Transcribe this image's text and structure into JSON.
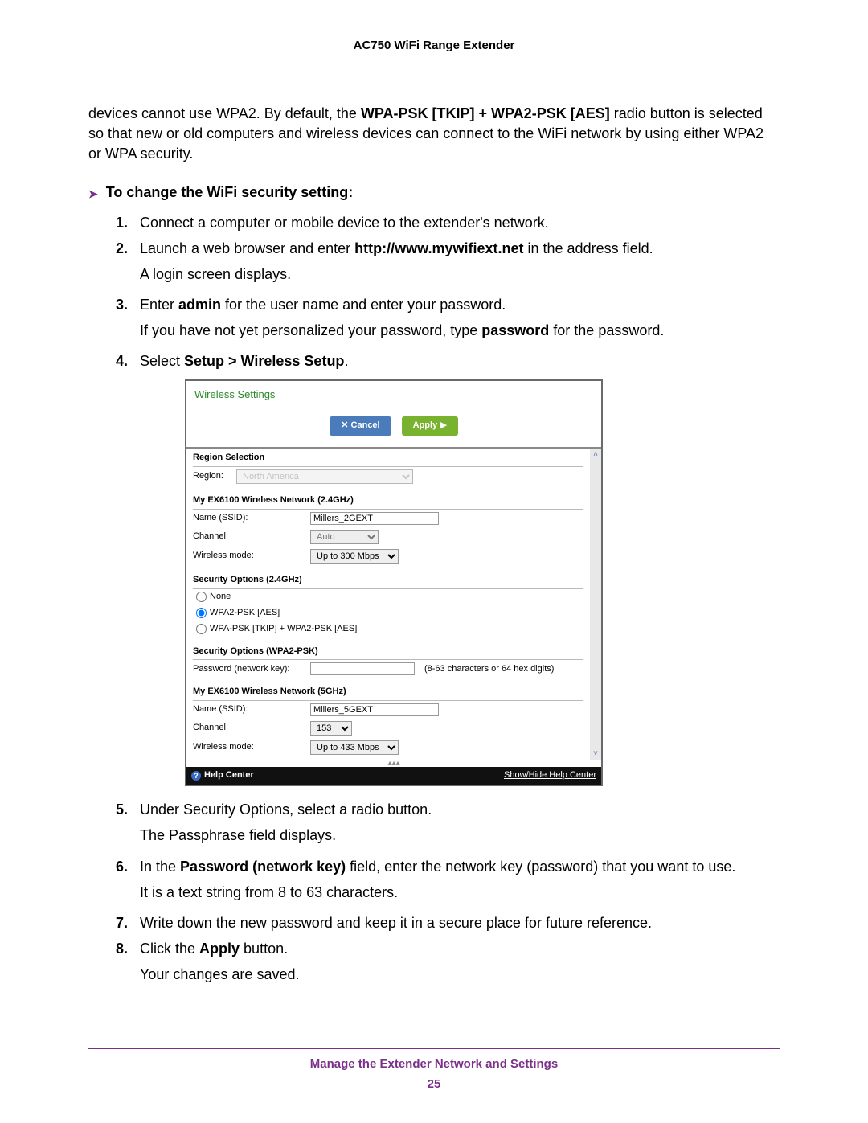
{
  "header": {
    "title": "AC750 WiFi Range Extender"
  },
  "intro": {
    "prefix": "devices cannot use WPA2. By default, the ",
    "bold": "WPA-PSK [TKIP] + WPA2-PSK [AES]",
    "suffix": " radio button is selected so that new or old computers and wireless devices can connect to the WiFi network by using either WPA2 or WPA security."
  },
  "heading": "To change the WiFi security setting:",
  "steps": {
    "s1": {
      "num": "1.",
      "text": "Connect a computer or mobile device to the extender's network."
    },
    "s2": {
      "num": "2.",
      "pre": "Launch a web browser and enter ",
      "bold": "http://www.mywifiext.net",
      "post": " in the address field.",
      "sub": "A login screen displays."
    },
    "s3": {
      "num": "3.",
      "pre": "Enter ",
      "bold1": "admin",
      "mid": " for the user name and enter your password.",
      "sub_pre": "If you have not yet personalized your password, type ",
      "sub_bold": "password",
      "sub_post": " for the password."
    },
    "s4": {
      "num": "4.",
      "pre": "Select ",
      "bold": "Setup > Wireless Setup",
      "post": "."
    },
    "s5": {
      "num": "5.",
      "text": "Under Security Options, select a radio button.",
      "sub": "The Passphrase field displays."
    },
    "s6": {
      "num": "6.",
      "pre": "In the ",
      "bold": "Password (network key)",
      "post": " field, enter the network key (password) that you want to use.",
      "sub": "It is a text string from 8 to 63 characters."
    },
    "s7": {
      "num": "7.",
      "text": "Write down the new password and keep it in a secure place for future reference."
    },
    "s8": {
      "num": "8.",
      "pre": "Click the ",
      "bold": "Apply",
      "post": " button.",
      "sub": "Your changes are saved."
    }
  },
  "shot": {
    "title": "Wireless Settings",
    "cancel": "✕ Cancel",
    "apply": "Apply ▶",
    "region_head": "Region Selection",
    "region_label": "Region:",
    "region_value": "North America",
    "net24_head": "My EX6100 Wireless Network (2.4GHz)",
    "ssid_label": "Name (SSID):",
    "ssid24_value": "Millers_2GEXT",
    "channel_label": "Channel:",
    "channel24_value": "Auto",
    "mode_label": "Wireless mode:",
    "mode24_value": "Up to 300 Mbps",
    "sec24_head": "Security Options (2.4GHz)",
    "radio_none": "None",
    "radio_wpa2": "WPA2-PSK [AES]",
    "radio_mixed": "WPA-PSK [TKIP] + WPA2-PSK [AES]",
    "secwpa2_head": "Security Options (WPA2-PSK)",
    "pw_label": "Password (network key):",
    "pw_hint": "(8-63 characters or 64 hex digits)",
    "net5_head": "My EX6100 Wireless Network (5GHz)",
    "ssid5_value": "Millers_5GEXT",
    "channel5_value": "153",
    "mode5_value": "Up to 433 Mbps",
    "help": "Help Center",
    "showhide": "Show/Hide Help Center"
  },
  "footer": {
    "chapter": "Manage the Extender Network and Settings",
    "page": "25"
  }
}
